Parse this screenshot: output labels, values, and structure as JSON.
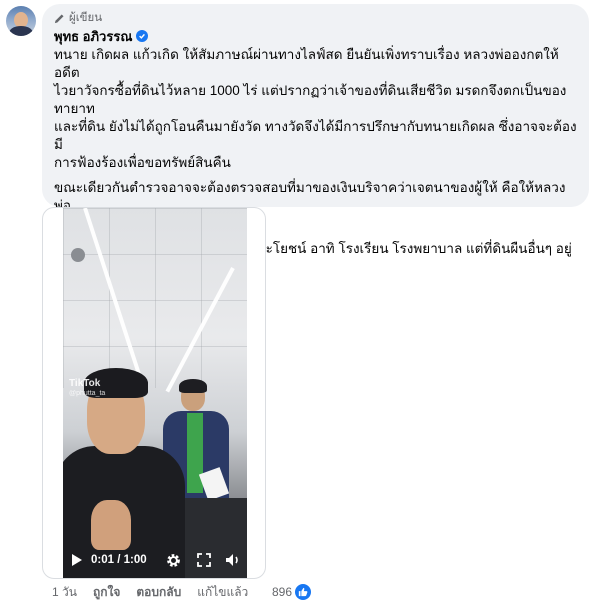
{
  "comment": {
    "role_label": "ผู้เขียน",
    "author_name": "พุทธ อภิวรรณ",
    "paragraphs": [
      "ทนาย เกิดผล แก้วเกิด ให้สัมภาษณ์ผ่านทางไลฟ์สด ยืนยันเพิ่งทราบเรื่อง หลวงพ่อองกตให้อดีต\nไวยาวัจกรซื้อที่ดินไว้หลาย 1000 ไร่ แต่ปรากฏว่าเจ้าของที่ดินเสียชีวิต มรดกจึงตกเป็นของทายาท\nและที่ดิน ยังไม่ได้ถูกโอนคืนมายังวัด ทางวัดจึงได้มีการปรึกษากับทนายเกิดผล ซึ่งอาจจะต้องมี\nการฟ้องร้องเพื่อขอทรัพย์สินคืน",
      "ขณะเดียวกันตำรวจอาจจะต้องตรวจสอบที่มาของเงินบริจาคว่าเจตนาของผู้ให้ คือให้หลวงพ่อ\nองลกตหรือให้วัดพระบาทน้ำพุ",
      "ปัจจุบันที่ดินดังกล่าวได้มีการใช้ทำประโยชน์ อาทิ โรงเรียน โรงพยาบาล แต่ที่ดินผืนอื่นๆ อยู่\nระหว่างการตรวจสอบ 🆗"
    ]
  },
  "video": {
    "watermark": "TikTok",
    "watermark_user": "@phutta_ta",
    "time_display": "0:01 / 1:00"
  },
  "footer": {
    "time": "1 วัน",
    "like": "ถูกใจ",
    "reply": "ตอบกลับ",
    "edited": "แก้ไขแล้ว",
    "reaction_count": "896"
  },
  "colors": {
    "bubble_bg": "#f0f2f5",
    "accent": "#1877f2",
    "meta_text": "#65676b"
  }
}
